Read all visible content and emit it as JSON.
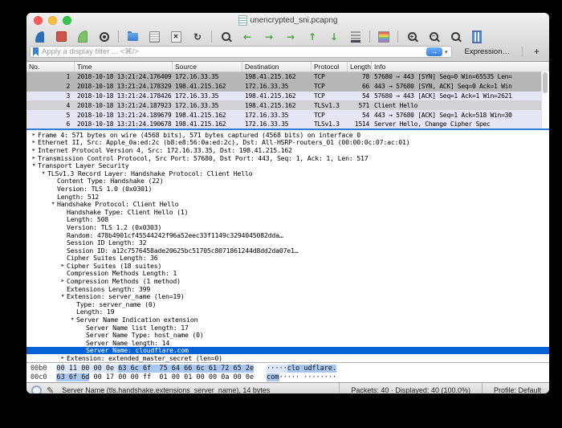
{
  "window": {
    "title": "unencrypted_sni.pcapng"
  },
  "toolbar": {
    "groups": [
      [
        "wireshark-fin",
        "stop-capture",
        "restart-capture",
        "capture-options"
      ],
      [
        "open-file",
        "save-file",
        "close-file",
        "reload-file"
      ],
      [
        "find-packet",
        "go-back",
        "go-forward",
        "go-to-packet",
        "go-first",
        "go-last",
        "auto-scroll"
      ],
      [
        "colorize-packets"
      ],
      [
        "zoom-in",
        "zoom-out",
        "zoom-reset",
        "resize-columns"
      ]
    ]
  },
  "filter": {
    "placeholder": "Apply a display filter ... <⌘/>",
    "apply_label": "→",
    "caret": "▾",
    "expression_label": "Expression…",
    "add_label": "+"
  },
  "packet_list": {
    "columns": [
      "No.",
      "Time",
      "Source",
      "Destination",
      "Protocol",
      "Length",
      "Info"
    ],
    "rows": [
      {
        "no": "1",
        "time": "2018-10-18 13:21:24.176409",
        "source": "172.16.33.35",
        "destination": "198.41.215.162",
        "protocol": "TCP",
        "length": "78",
        "info": "57680 → 443 [SYN] Seq=0 Win=65535 Len=",
        "style": "gray"
      },
      {
        "no": "2",
        "time": "2018-10-18 13:21:24.178329",
        "source": "198.41.215.162",
        "destination": "172.16.33.35",
        "protocol": "TCP",
        "length": "66",
        "info": "443 → 57680 [SYN, ACK] Seq=0 Ack=1 Win",
        "style": "gray"
      },
      {
        "no": "3",
        "time": "2018-10-18 13:21:24.178426",
        "source": "172.16.33.35",
        "destination": "198.41.215.162",
        "protocol": "TCP",
        "length": "54",
        "info": "57680 → 443 [ACK] Seq=1 Ack=1 Win=2621",
        "style": "lav"
      },
      {
        "no": "4",
        "time": "2018-10-18 13:21:24.187923",
        "source": "172.16.33.35",
        "destination": "198.41.215.162",
        "protocol": "TLSv1.3",
        "length": "571",
        "info": "Client Hello",
        "style": "selgray"
      },
      {
        "no": "5",
        "time": "2018-10-18 13:21:24.189679",
        "source": "198.41.215.162",
        "destination": "172.16.33.35",
        "protocol": "TCP",
        "length": "54",
        "info": "443 → 57680 [ACK] Seq=1 Ack=518 Win=30",
        "style": "lav"
      },
      {
        "no": "6",
        "time": "2018-10-18 13:21:24.190678",
        "source": "198.41.215.162",
        "destination": "172.16.33.35",
        "protocol": "TLSv1.3",
        "length": "1514",
        "info": "Server Hello, Change Cipher Spec",
        "style": "lav"
      }
    ]
  },
  "detail_tree": {
    "lines": [
      {
        "indent": 0,
        "arrow": "right",
        "text": "Frame 4: 571 bytes on wire (4568 bits), 571 bytes captured (4568 bits) on interface 0"
      },
      {
        "indent": 0,
        "arrow": "right",
        "text": "Ethernet II, Src: Apple_0a:ed:2c (b8:e8:56:0a:ed:2c), Dst: All-HSRP-routers_01 (00:00:0c:07:ac:01)"
      },
      {
        "indent": 0,
        "arrow": "right",
        "text": "Internet Protocol Version 4, Src: 172.16.33.35, Dst: 198.41.215.162"
      },
      {
        "indent": 0,
        "arrow": "right",
        "text": "Transmission Control Protocol, Src Port: 57680, Dst Port: 443, Seq: 1, Ack: 1, Len: 517"
      },
      {
        "indent": 0,
        "arrow": "down",
        "text": "Transport Layer Security"
      },
      {
        "indent": 1,
        "arrow": "down",
        "text": "TLSv1.3 Record Layer: Handshake Protocol: Client Hello"
      },
      {
        "indent": 2,
        "arrow": "none",
        "text": "Content Type: Handshake (22)"
      },
      {
        "indent": 2,
        "arrow": "none",
        "text": "Version: TLS 1.0 (0x0301)"
      },
      {
        "indent": 2,
        "arrow": "none",
        "text": "Length: 512"
      },
      {
        "indent": 2,
        "arrow": "down",
        "text": "Handshake Protocol: Client Hello"
      },
      {
        "indent": 3,
        "arrow": "none",
        "text": "Handshake Type: Client Hello (1)"
      },
      {
        "indent": 3,
        "arrow": "none",
        "text": "Length: 508"
      },
      {
        "indent": 3,
        "arrow": "none",
        "text": "Version: TLS 1.2 (0x0303)"
      },
      {
        "indent": 3,
        "arrow": "none",
        "text": "Random: 478b4901cf45544242f96a52eec33f1149c3294045082dda…"
      },
      {
        "indent": 3,
        "arrow": "none",
        "text": "Session ID Length: 32"
      },
      {
        "indent": 3,
        "arrow": "none",
        "text": "Session ID: a12c7576458ade20625bc51705c8071861244d8dd2da07e1…"
      },
      {
        "indent": 3,
        "arrow": "none",
        "text": "Cipher Suites Length: 36"
      },
      {
        "indent": 3,
        "arrow": "right",
        "text": "Cipher Suites (18 suites)"
      },
      {
        "indent": 3,
        "arrow": "none",
        "text": "Compression Methods Length: 1"
      },
      {
        "indent": 3,
        "arrow": "right",
        "text": "Compression Methods (1 method)"
      },
      {
        "indent": 3,
        "arrow": "none",
        "text": "Extensions Length: 399"
      },
      {
        "indent": 3,
        "arrow": "down",
        "text": "Extension: server_name (len=19)"
      },
      {
        "indent": 4,
        "arrow": "none",
        "text": "Type: server_name (0)"
      },
      {
        "indent": 4,
        "arrow": "none",
        "text": "Length: 19"
      },
      {
        "indent": 4,
        "arrow": "down",
        "text": "Server Name Indication extension"
      },
      {
        "indent": 5,
        "arrow": "none",
        "text": "Server Name list length: 17"
      },
      {
        "indent": 5,
        "arrow": "none",
        "text": "Server Name Type: host_name (0)"
      },
      {
        "indent": 5,
        "arrow": "none",
        "text": "Server Name length: 14"
      },
      {
        "indent": 5,
        "arrow": "none",
        "text": "Server Name: cloudflare.com",
        "selected": true
      },
      {
        "indent": 3,
        "arrow": "right",
        "text": "Extension: extended_master_secret (len=0)"
      }
    ]
  },
  "hex_view": {
    "rows": [
      {
        "offset": "00b0",
        "hex": [
          {
            "t": "00 11 00 00 0e ",
            "h": "light"
          },
          {
            "t": "63 6c 6f  75 64 66 6c 61 72 65 2e",
            "h": "dark"
          }
        ],
        "ascii": [
          {
            "t": "·····",
            "h": "light"
          },
          {
            "t": "clo udflare.",
            "h": "dark"
          }
        ]
      },
      {
        "offset": "00c0",
        "hex": [
          {
            "t": "63 6f 6d",
            "h": "dark"
          },
          {
            "t": " 00 17 00 00 ff  01 00 01 00 00 0a 00 0e",
            "h": "none"
          }
        ],
        "ascii": [
          {
            "t": "com",
            "h": "dark"
          },
          {
            "t": "····· ········",
            "h": "none"
          }
        ]
      }
    ]
  },
  "status_bar": {
    "field_info": "Server Name (tls.handshake.extensions_server_name), 14 bytes",
    "packets_info": "Packets: 40 · Displayed: 40 (100.0%)",
    "profile": "Profile: Default"
  }
}
